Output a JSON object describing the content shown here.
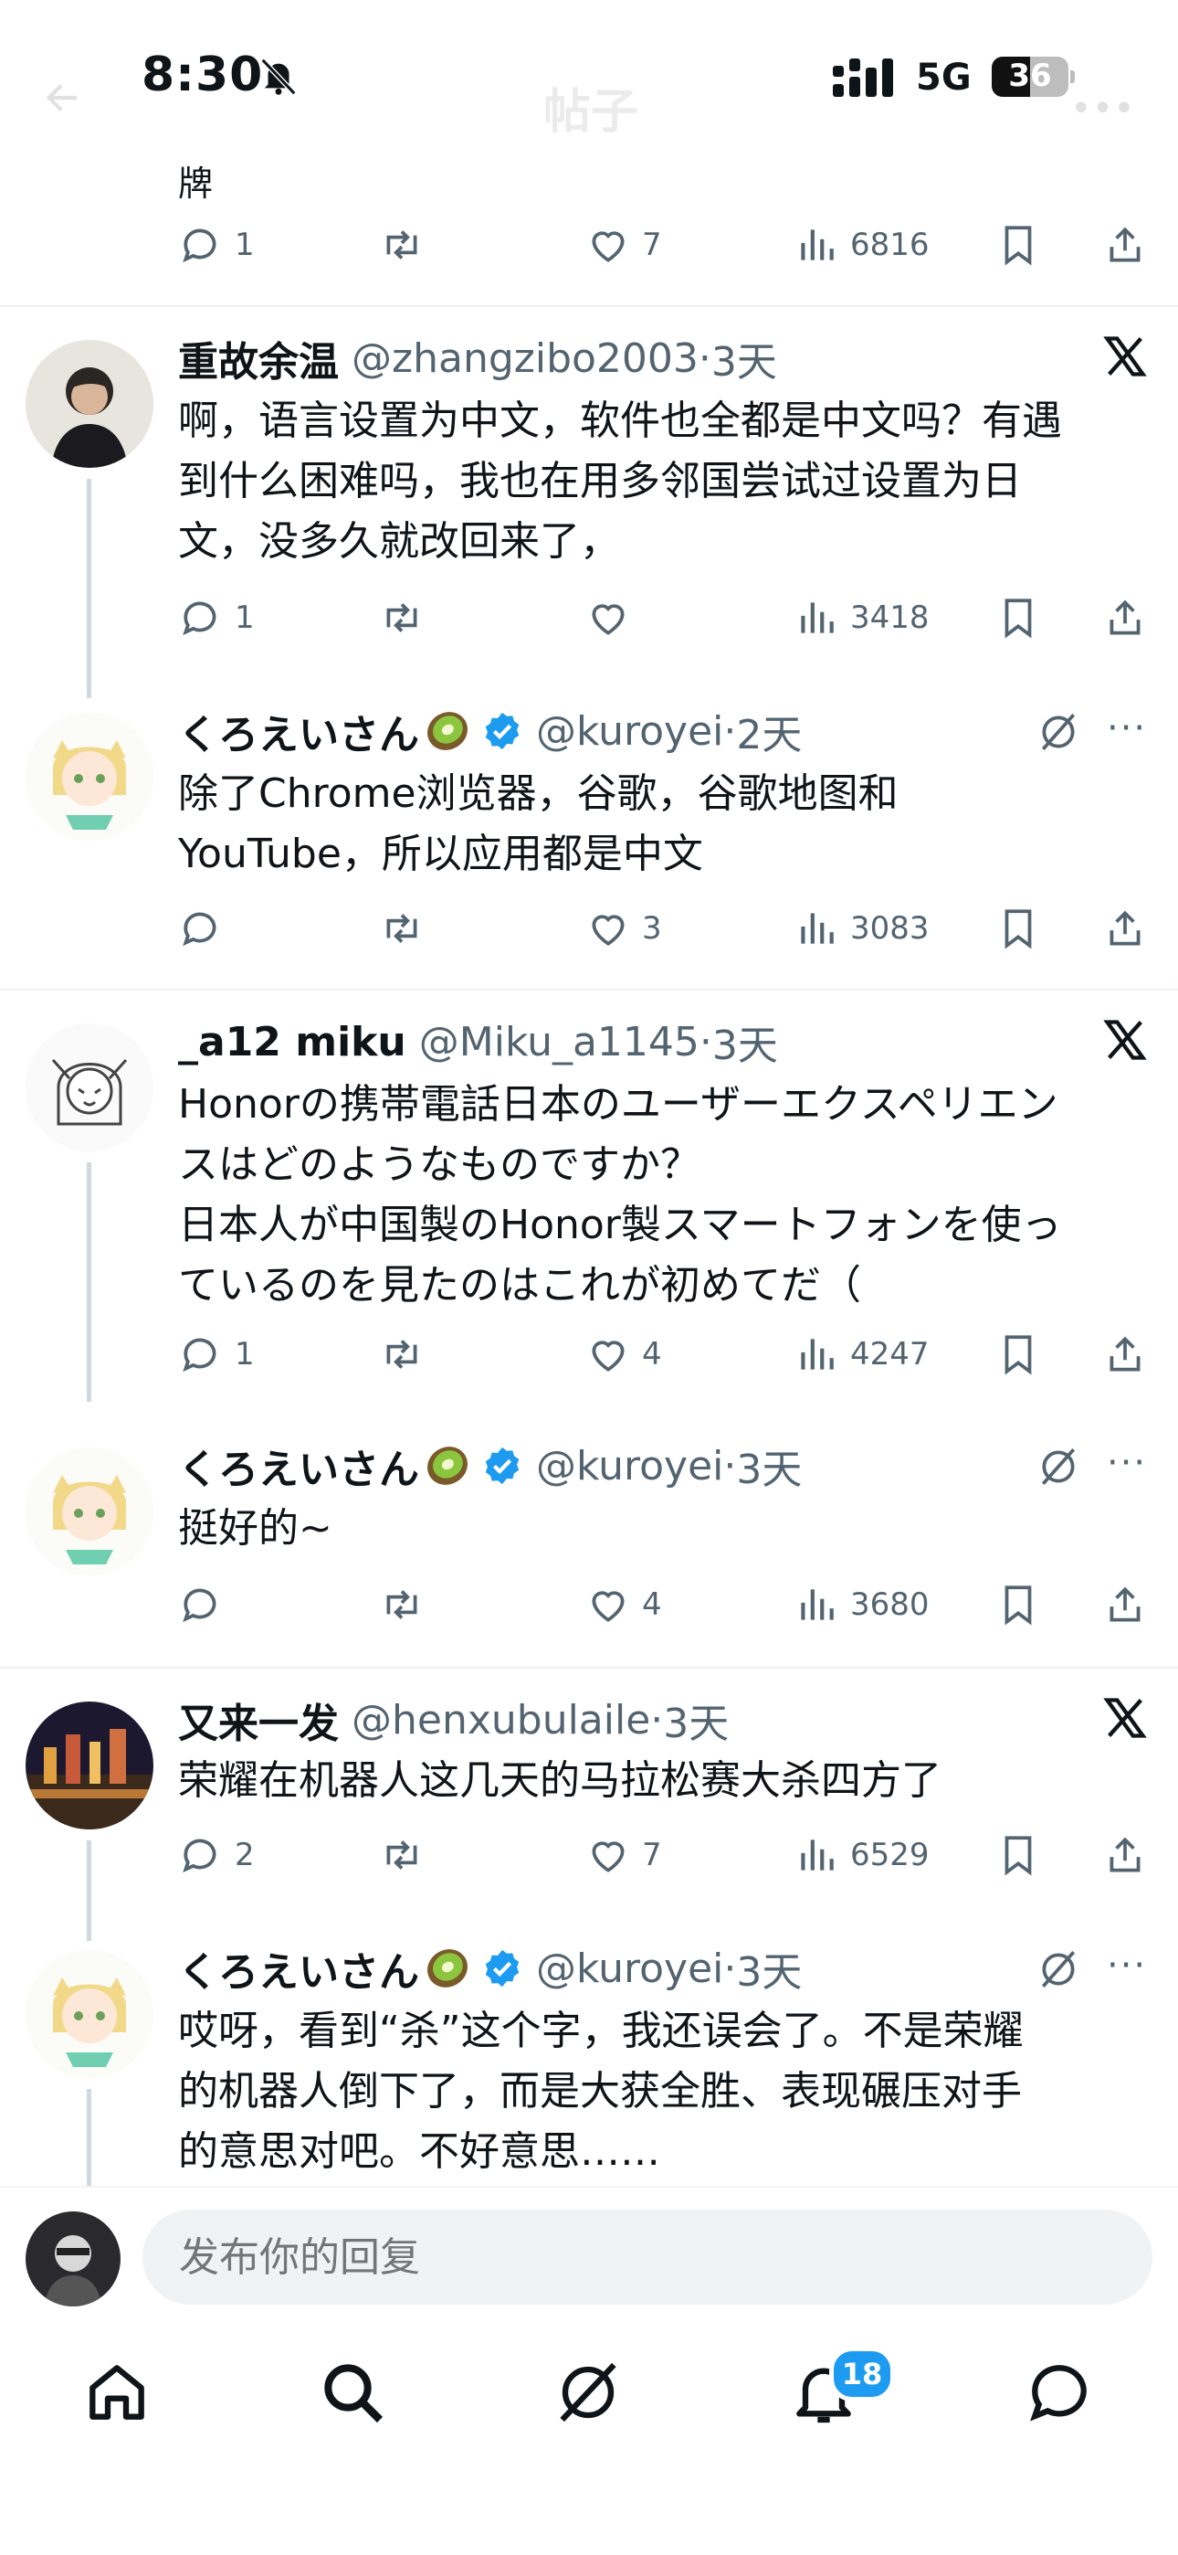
{
  "status_bar": {
    "time": "8:30",
    "network": "5G",
    "battery_level": "36",
    "icons": [
      "bell-slash-icon",
      "signal-bars-icon",
      "battery-icon"
    ]
  },
  "header_ghost": {
    "title": "帖子"
  },
  "fragment_text": "牌",
  "tweets": [
    {
      "name": "",
      "handle": "",
      "time": "",
      "text": "",
      "replies": "1",
      "retweets": "",
      "likes": "7",
      "views": "6816"
    },
    {
      "name": "重故余温",
      "handle": "@zhangzibo2003",
      "time": "3天",
      "text": "啊，语言设置为中文，软件也全都是中文吗？有遇\n到什么困难吗，我也在用多邻国尝试过设置为日\n文，没多久就改回来了，",
      "replies": "1",
      "retweets": "",
      "likes": "",
      "views": "3418"
    },
    {
      "name": "くろえいさん",
      "handle": "@kuroyei",
      "time": "2天",
      "text": "除了Chrome浏览器，谷歌，谷歌地图和\nYouTube，所以应用都是中文",
      "replies": "",
      "retweets": "",
      "likes": "3",
      "views": "3083"
    },
    {
      "name": "_a12 miku",
      "handle": "@Miku_a1145",
      "time": "3天",
      "text": "Honorの携帯電話日本のユーザーエクスペリエン\nスはどのようなものですか？\n日本人が中国製のHonor製スマートフォンを使っ\nているのを見たのはこれが初めてだ（",
      "replies": "1",
      "retweets": "",
      "likes": "4",
      "views": "4247"
    },
    {
      "name": "くろえいさん",
      "handle": "@kuroyei",
      "time": "3天",
      "text": "挺好的~",
      "replies": "",
      "retweets": "",
      "likes": "4",
      "views": "3680"
    },
    {
      "name": "又来一发",
      "handle": "@henxubulaile",
      "time": "3天",
      "text": "荣耀在机器人这几天的马拉松赛大杀四方了",
      "replies": "2",
      "retweets": "",
      "likes": "7",
      "views": "6529"
    },
    {
      "name": "くろえいさん",
      "handle": "@kuroyei",
      "time": "3天",
      "text": "哎呀，看到“杀”这个字，我还误会了。不是荣耀\n的机器人倒下了，而是大获全胜、表现碾压对手\n的意思对吧。不好意思……",
      "replies": "",
      "retweets": "",
      "likes": "",
      "views": ""
    }
  ],
  "reply_bar": {
    "placeholder": "发布你的回复"
  },
  "tab_bar": {
    "items": [
      "home-tab",
      "search-tab",
      "grok-tab",
      "notifications-tab",
      "messages-tab"
    ],
    "notifications_badge": "18"
  },
  "colors": {
    "accent": "#1d9bf0",
    "muted": "#536471",
    "text": "#0f1419",
    "divider": "#eff3f4"
  }
}
